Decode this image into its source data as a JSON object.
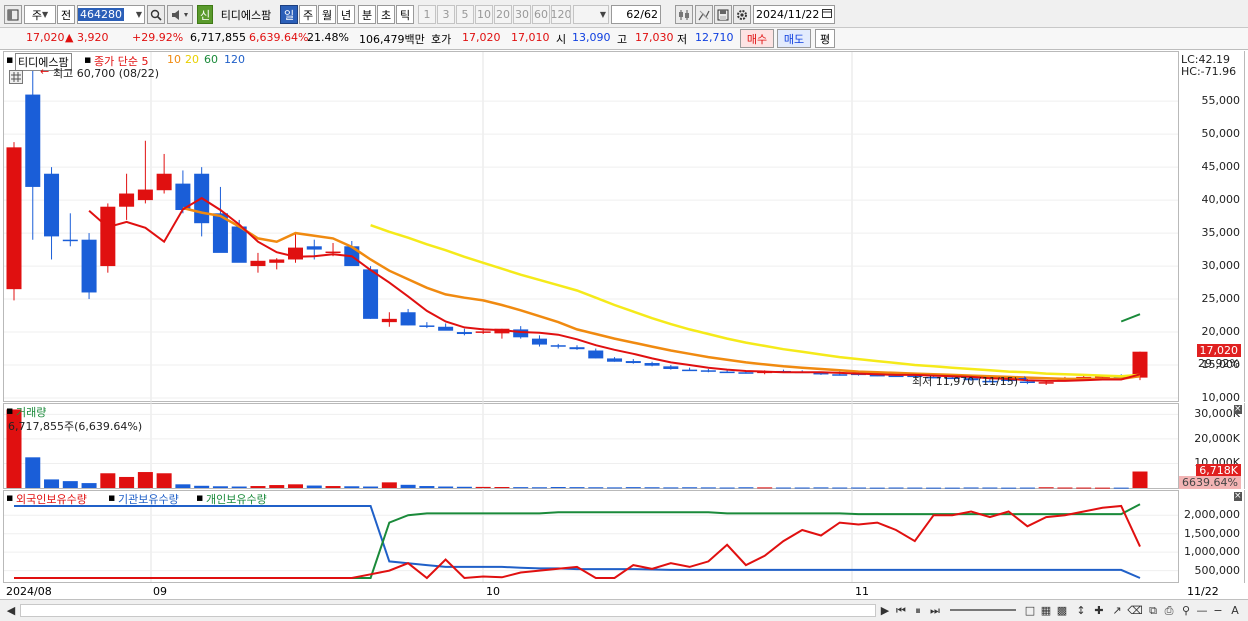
{
  "toolbar": {
    "market": "주",
    "prev_label": "전",
    "code": "464280",
    "sin_badge": "신",
    "stock_name": "티디에스팜",
    "periods": [
      "일",
      "주",
      "월",
      "년",
      "분",
      "초",
      "틱"
    ],
    "intervals": [
      "1",
      "3",
      "5",
      "10",
      "20",
      "30",
      "60",
      "120"
    ],
    "count": "62",
    "count_total": "/62",
    "date": "2024/11/22"
  },
  "quote": {
    "price": "17,020",
    "change": "▲ 3,920",
    "change_pct": "+29.92%",
    "volume": "6,717,855",
    "volume_pct": "6,639.64%",
    "turnover": "21.48%",
    "amount": "106,479백만",
    "hoga_label": "호가",
    "hoga_sell": "17,020",
    "hoga_buy": "17,010",
    "open_label": "시",
    "open": "13,090",
    "high_label": "고",
    "high": "17,030",
    "low_label": "저",
    "low": "12,710",
    "buy_label": "매수",
    "sell_label": "매도",
    "eval_label": "평"
  },
  "price_pane": {
    "name": "티디에스팜",
    "ma_title": "종가 단순 5",
    "ma_periods": [
      "10",
      "20",
      "60",
      "120"
    ],
    "ma_colors": [
      "#e01010",
      "#f08a10",
      "#f0e000",
      "#1a8a3a",
      "#2060c8"
    ],
    "high_note": "최고 60,700 (08/22)",
    "low_note": "최저 11,970 (11/15)",
    "lc": "LC:42.19",
    "hc": "HC:-71.96",
    "last_price_tag": "17,020",
    "last_pct_tag": "29.92%",
    "yticks": [
      "55,000",
      "50,000",
      "45,000",
      "40,000",
      "35,000",
      "30,000",
      "25,000",
      "20,000",
      "15,000",
      "10,000"
    ]
  },
  "volume_pane": {
    "title": "거래량",
    "last_value": "6,717,855주(6,639.64%)",
    "yticks": [
      "30,000K",
      "20,000K",
      "10,000K"
    ],
    "tag_value": "6,718K",
    "tag_pct": "6639.64%"
  },
  "holding_pane": {
    "titles": [
      "외국인보유수량",
      "기관보유수량",
      "개인보유수량"
    ],
    "title_colors": [
      "#e01010",
      "#2060c8",
      "#1a8a3a"
    ],
    "yticks": [
      "2,000,000",
      "1,500,000",
      "1,000,000",
      "500,000"
    ]
  },
  "xaxis": {
    "labels": [
      "2024/08",
      "09",
      "10",
      "11",
      "11/22"
    ]
  },
  "chart_data": {
    "type": "candlestick",
    "dates": [
      "08/22",
      "08/23",
      "08/26",
      "08/27",
      "08/28",
      "08/29",
      "08/30",
      "09/02",
      "09/03",
      "09/04",
      "09/05",
      "09/06",
      "09/09",
      "09/10",
      "09/11",
      "09/12",
      "09/13",
      "09/19",
      "09/20",
      "09/23",
      "09/24",
      "09/25",
      "09/26",
      "09/27",
      "09/30",
      "10/02",
      "10/04",
      "10/07",
      "10/08",
      "10/10",
      "10/11",
      "10/14",
      "10/15",
      "10/16",
      "10/17",
      "10/18",
      "10/21",
      "10/22",
      "10/23",
      "10/24",
      "10/25",
      "10/28",
      "10/29",
      "10/30",
      "10/31",
      "11/01",
      "11/04",
      "11/05",
      "11/06",
      "11/07",
      "11/08",
      "11/11",
      "11/12",
      "11/13",
      "11/14",
      "11/15",
      "11/18",
      "11/19",
      "11/20",
      "11/21",
      "11/22"
    ],
    "open": [
      26500,
      56000,
      44000,
      34000,
      34000,
      30000,
      39000,
      40000,
      41500,
      42500,
      44000,
      38000,
      36000,
      30000,
      30500,
      31000,
      33000,
      32000,
      33000,
      29500,
      21500,
      23000,
      21000,
      20800,
      20000,
      20000,
      19800,
      20400,
      19000,
      18000,
      17700,
      17200,
      16000,
      15600,
      15300,
      14800,
      14300,
      14200,
      14000,
      13900,
      13800,
      14100,
      14000,
      13800,
      13600,
      13700,
      13500,
      13400,
      13400,
      13200,
      13100,
      13000,
      12600,
      12800,
      12500,
      12200,
      12700,
      13000,
      13100,
      13300,
      13090
    ],
    "high": [
      48800,
      60700,
      45000,
      38000,
      35000,
      39500,
      44000,
      49000,
      47000,
      44500,
      45000,
      42000,
      37000,
      32000,
      31200,
      35000,
      34000,
      33500,
      33800,
      30000,
      23000,
      23500,
      21500,
      21300,
      20500,
      20600,
      20500,
      20900,
      19500,
      18200,
      18000,
      17500,
      16200,
      15900,
      15500,
      15000,
      14600,
      14400,
      14200,
      14100,
      14200,
      14300,
      14200,
      14000,
      14000,
      13900,
      13700,
      13600,
      13600,
      13400,
      13300,
      13200,
      13000,
      13000,
      12900,
      12500,
      13200,
      13400,
      13500,
      13600,
      17030
    ],
    "low": [
      24800,
      34000,
      31000,
      33000,
      25000,
      29000,
      37000,
      39500,
      41000,
      38000,
      34500,
      35000,
      33000,
      29000,
      29500,
      30500,
      31000,
      31500,
      32000,
      22000,
      20800,
      21000,
      20600,
      20300,
      19500,
      19700,
      19000,
      19000,
      17800,
      17500,
      17300,
      16000,
      15500,
      15200,
      14800,
      14300,
      14100,
      13900,
      13800,
      13700,
      13600,
      13900,
      13800,
      13500,
      13400,
      13400,
      13300,
      13200,
      13200,
      13000,
      12900,
      12600,
      12400,
      12400,
      12100,
      11970,
      12500,
      12800,
      12900,
      13000,
      12710
    ],
    "close": [
      48000,
      42000,
      34500,
      33800,
      26000,
      39000,
      41000,
      41600,
      44000,
      38500,
      36500,
      32000,
      30500,
      30800,
      31000,
      32800,
      32500,
      32200,
      30000,
      22000,
      22000,
      21000,
      20800,
      20200,
      19700,
      20100,
      20500,
      19200,
      18100,
      17800,
      17400,
      16000,
      15500,
      15300,
      14900,
      14400,
      14200,
      14000,
      13900,
      13800,
      14000,
      14000,
      13900,
      13600,
      13500,
      13600,
      13400,
      13300,
      13300,
      13100,
      13000,
      12700,
      12500,
      12700,
      12300,
      12400,
      12900,
      13200,
      13300,
      13100,
      17020
    ],
    "volume": [
      32000,
      12500,
      3500,
      2800,
      2000,
      6000,
      4500,
      6500,
      6000,
      1500,
      900,
      700,
      600,
      800,
      1200,
      1500,
      1000,
      800,
      700,
      600,
      2300,
      1300,
      800,
      600,
      500,
      450,
      400,
      350,
      300,
      400,
      350,
      300,
      250,
      350,
      300,
      250,
      300,
      250,
      200,
      300,
      250,
      200,
      200,
      250,
      200,
      200,
      150,
      200,
      180,
      150,
      150,
      220,
      200,
      150,
      180,
      300,
      200,
      180,
      150,
      150,
      6718
    ],
    "volume_unit": "K",
    "ylim": [
      10000,
      62000
    ],
    "ma5": [
      null,
      null,
      null,
      null,
      38400,
      35900,
      36700,
      35800,
      33700,
      38600,
      40300,
      38500,
      36300,
      33700,
      32100,
      31400,
      31500,
      31800,
      31500,
      29400,
      27500,
      25400,
      23200,
      21600,
      20700,
      20400,
      20300,
      20000,
      19900,
      19600,
      18900,
      18000,
      17300,
      16700,
      16000,
      15400,
      15000,
      14600,
      14300,
      14100,
      14000,
      13900,
      13900,
      13900,
      13800,
      13700,
      13600,
      13500,
      13500,
      13400,
      13300,
      13200,
      13000,
      12900,
      12700,
      12600,
      12600,
      12700,
      12800,
      12800,
      13600
    ],
    "ma10": [
      null,
      null,
      null,
      null,
      null,
      null,
      null,
      null,
      null,
      38800,
      38100,
      37600,
      36000,
      34200,
      33700,
      35000,
      34600,
      34200,
      32900,
      31000,
      29300,
      28000,
      26700,
      25700,
      25200,
      24800,
      24100,
      23300,
      22400,
      21500,
      20400,
      19700,
      19000,
      18400,
      17800,
      17200,
      16700,
      16200,
      15800,
      15400,
      15100,
      14800,
      14600,
      14400,
      14200,
      14000,
      13900,
      13800,
      13700,
      13600,
      13500,
      13400,
      13300,
      13200,
      13100,
      13000,
      12900,
      12900,
      12900,
      12900,
      13300
    ],
    "ma20": [
      null,
      null,
      null,
      null,
      null,
      null,
      null,
      null,
      null,
      null,
      null,
      null,
      null,
      null,
      null,
      null,
      null,
      null,
      null,
      36200,
      35200,
      34300,
      33300,
      32400,
      31400,
      30500,
      29600,
      28700,
      27900,
      27100,
      26300,
      25200,
      24100,
      23100,
      22100,
      21200,
      20400,
      19700,
      19000,
      18400,
      17900,
      17400,
      17000,
      16600,
      16200,
      15900,
      15600,
      15300,
      15000,
      14800,
      14600,
      14400,
      14200,
      14000,
      13900,
      13700,
      13600,
      13500,
      13400,
      13300,
      13500
    ],
    "ma60": [
      null,
      null,
      null,
      null,
      null,
      null,
      null,
      null,
      null,
      null,
      null,
      null,
      null,
      null,
      null,
      null,
      null,
      null,
      null,
      null,
      null,
      null,
      null,
      null,
      null,
      null,
      null,
      null,
      null,
      null,
      null,
      null,
      null,
      null,
      null,
      null,
      null,
      null,
      null,
      null,
      null,
      null,
      null,
      null,
      null,
      null,
      null,
      null,
      null,
      null,
      null,
      null,
      null,
      null,
      null,
      null,
      null,
      null,
      null,
      21600,
      22700
    ],
    "foreign_holding": [
      0,
      0,
      0,
      0,
      0,
      0,
      0,
      0,
      100000,
      200000,
      100000,
      60000,
      50000,
      50000,
      60000,
      80000,
      40000,
      50000,
      0,
      400000,
      500000,
      700000,
      250000,
      800000,
      300000,
      340000,
      320000,
      450000,
      500000,
      550000,
      600000,
      150000,
      250000,
      650000,
      550000,
      700000,
      600000,
      750000,
      1200000,
      650000,
      900000,
      1300000,
      1600000,
      1450000,
      1800000,
      1750000,
      1800000,
      1600000,
      1300000,
      2000000,
      2000000,
      2100000,
      1950000,
      2100000,
      1700000,
      1950000,
      2000000,
      2100000,
      2200000,
      2250000,
      1150000
    ],
    "institution_holding": [
      2250000,
      2250000,
      2250000,
      2250000,
      2250000,
      2250000,
      2250000,
      2250000,
      2250000,
      2250000,
      2250000,
      2250000,
      2250000,
      2250000,
      2250000,
      2250000,
      2250000,
      2250000,
      2250000,
      2250000,
      750000,
      700000,
      650000,
      600000,
      600000,
      600000,
      600000,
      580000,
      560000,
      560000,
      540000,
      540000,
      540000,
      540000,
      530000,
      520000,
      520000,
      520000,
      520000,
      520000,
      520000,
      520000,
      520000,
      520000,
      520000,
      520000,
      520000,
      520000,
      520000,
      520000,
      520000,
      520000,
      520000,
      520000,
      520000,
      520000,
      520000,
      520000,
      520000,
      520000,
      300000
    ],
    "individual_holding": [
      0,
      0,
      0,
      0,
      0,
      0,
      0,
      0,
      -50000,
      -50000,
      -50000,
      -50000,
      -50000,
      -50000,
      -50000,
      -50000,
      -50000,
      -50000,
      -50000,
      -50000,
      1800000,
      2000000,
      2050000,
      2050000,
      2050000,
      2050000,
      2050000,
      2050000,
      2050000,
      2080000,
      2080000,
      2080000,
      2080000,
      2080000,
      2080000,
      2080000,
      2080000,
      2080000,
      2050000,
      2050000,
      2050000,
      2050000,
      2050000,
      2050000,
      2050000,
      2030000,
      2030000,
      2030000,
      2030000,
      2030000,
      2030000,
      2030000,
      2030000,
      2030000,
      2030000,
      2030000,
      2030000,
      2030000,
      2030000,
      2030000,
      2300000
    ],
    "holding_ylim": [
      300000,
      2250000
    ]
  }
}
